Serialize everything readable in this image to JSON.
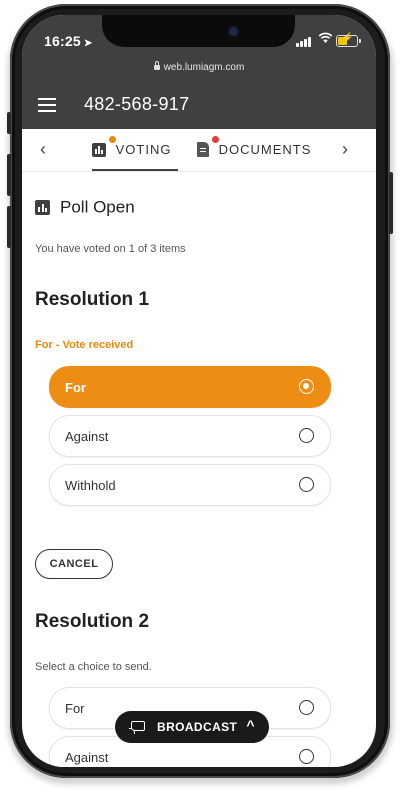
{
  "status_bar": {
    "time": "16:25",
    "location_arrow": "➤"
  },
  "browser": {
    "url": "web.lumiagm.com"
  },
  "app_bar": {
    "meeting_id": "482-568-917"
  },
  "tabs": {
    "prev_arrow": "‹",
    "next_arrow": "›",
    "items": [
      {
        "label": "VOTING",
        "active": true,
        "dot_color": "#e8890c"
      },
      {
        "label": "DOCUMENTS",
        "active": false,
        "dot_color": "#e53935"
      }
    ]
  },
  "poll": {
    "title": "Poll Open",
    "progress_text": "You have voted on 1 of 3 items",
    "resolutions": [
      {
        "title": "Resolution 1",
        "status": "For - Vote received",
        "options": [
          {
            "label": "For",
            "selected": true
          },
          {
            "label": "Against",
            "selected": false
          },
          {
            "label": "Withhold",
            "selected": false
          }
        ],
        "cancel_label": "CANCEL"
      },
      {
        "title": "Resolution 2",
        "hint": "Select a choice to send.",
        "options": [
          {
            "label": "For",
            "selected": false
          },
          {
            "label": "Against",
            "selected": false
          }
        ]
      }
    ]
  },
  "broadcast": {
    "label": "BROADCAST",
    "chevron": "^"
  },
  "colors": {
    "accent": "#ee8d14",
    "header_bg": "#3f4042",
    "status_orange": "#e8890c"
  }
}
